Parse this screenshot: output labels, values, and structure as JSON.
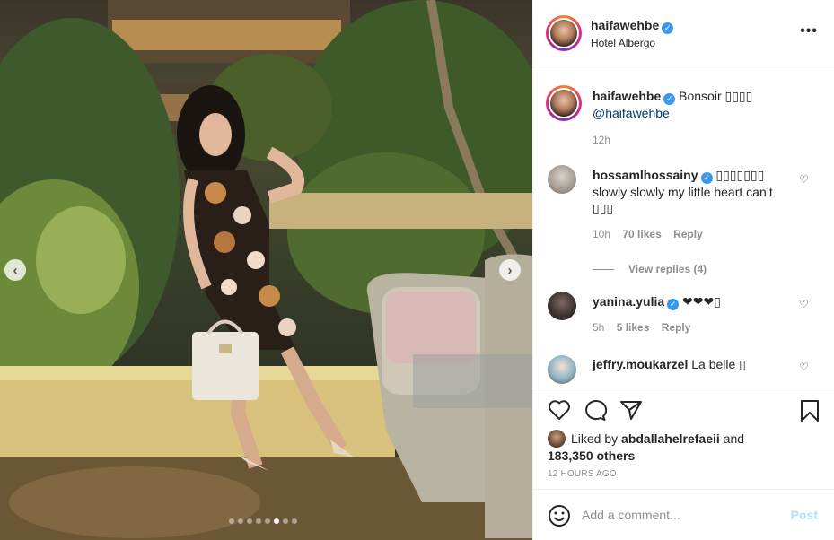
{
  "photo": {
    "prev_icon": "chevron-left",
    "next_icon": "chevron-right",
    "slide_count": 8,
    "active_slide": 6
  },
  "header": {
    "username": "haifawehbe",
    "location": "Hotel Albergo",
    "more_icon": "more-horizontal"
  },
  "caption": {
    "username": "haifawehbe",
    "text": "Bonsoir ▯▯▯▯",
    "mention": "@haifawehbe",
    "time": "12h"
  },
  "comments": [
    {
      "username": "hossamlhossainy",
      "text_line1": "▯▯▯▯▯▯▯",
      "text_line2": "slowly slowly my little heart can’t",
      "text_line3": "▯▯▯",
      "time": "10h",
      "likes": "70 likes",
      "reply": "Reply",
      "view_replies": "View replies (4)"
    },
    {
      "username": "yanina.yulia",
      "text": "❤❤❤▯",
      "time": "5h",
      "likes": "5 likes",
      "reply": "Reply"
    },
    {
      "username": "jeffry.moukarzel",
      "text": "La belle ▯"
    }
  ],
  "actions": {
    "like_icon": "heart-outline",
    "comment_icon": "comment-bubble",
    "share_icon": "paper-plane",
    "save_icon": "bookmark"
  },
  "likes": {
    "prefix": "Liked by",
    "user": "abdallahelrefaeii",
    "and": "and",
    "others": "183,350 others"
  },
  "timestamp": "12 HOURS AGO",
  "add_comment": {
    "placeholder": "Add a comment...",
    "post_label": "Post",
    "emoji_icon": "smiley"
  },
  "colors": {
    "verified": "#3897f0",
    "post_disabled": "#b2dffc",
    "meta_gray": "#8e8e8e"
  }
}
